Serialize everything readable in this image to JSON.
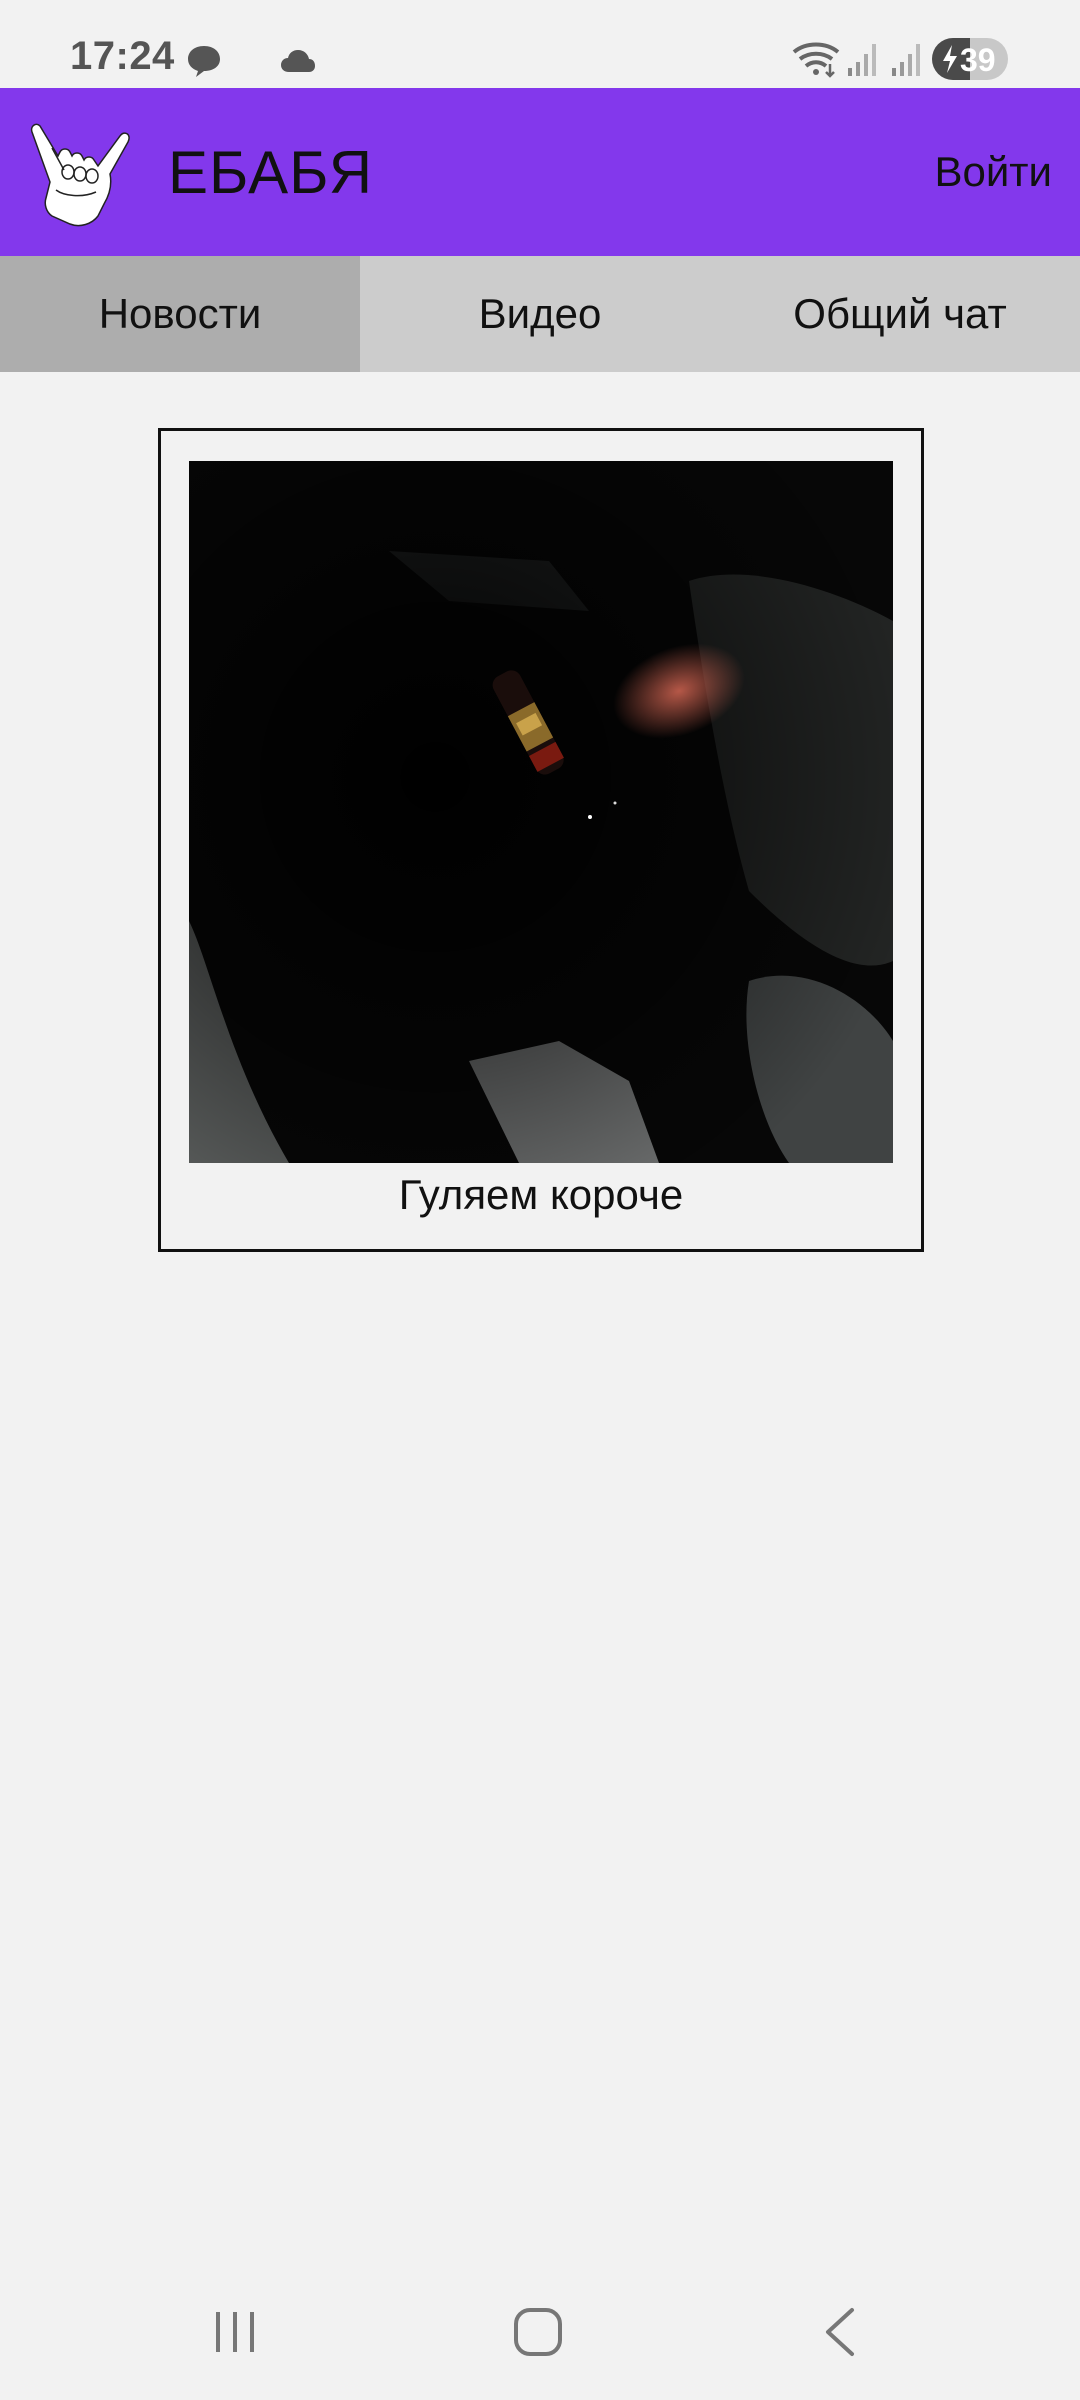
{
  "status_bar": {
    "time": "17:24",
    "battery": "39",
    "icons": [
      "chat-icon",
      "cloud-icon",
      "wifi-icon",
      "signal-icon",
      "signal-icon",
      "battery-charging-icon"
    ]
  },
  "header": {
    "title": "ЕБАБЯ",
    "login_label": "Войти",
    "logo_icon": "shaka-hand-logo",
    "background_color": "#8338ec"
  },
  "tabs": [
    {
      "label": "Новости",
      "active": true
    },
    {
      "label": "Видео",
      "active": false
    },
    {
      "label": "Общий чат",
      "active": false
    }
  ],
  "posts": [
    {
      "caption": "Гуляем короче",
      "image": "dark-night-photo"
    }
  ],
  "nav_bar": {
    "icons": [
      "recent-apps-icon",
      "home-icon",
      "back-icon"
    ]
  }
}
